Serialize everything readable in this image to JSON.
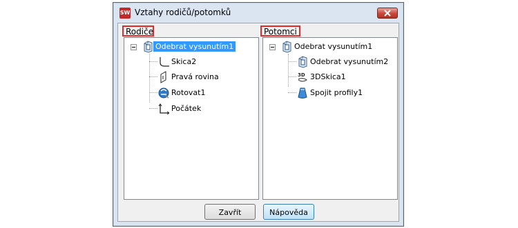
{
  "window": {
    "title": "Vztahy rodičů/potomků",
    "app_icon_text": "SW",
    "close_icon": "close-x-icon"
  },
  "parents": {
    "label": "Rodiče",
    "root": {
      "label": "Odebrat vysunutím1",
      "icon": "cut-extrude-icon",
      "selected": true,
      "expanded": true
    },
    "items": [
      {
        "label": "Skica2",
        "icon": "sketch-icon"
      },
      {
        "label": "Pravá rovina",
        "icon": "plane-icon"
      },
      {
        "label": "Rotovat1",
        "icon": "revolve-icon"
      },
      {
        "label": "Počátek",
        "icon": "origin-icon"
      }
    ]
  },
  "children": {
    "label": "Potomci",
    "root": {
      "label": "Odebrat vysunutím1",
      "icon": "cut-extrude-icon",
      "expanded": true
    },
    "items": [
      {
        "label": "Odebrat vysunutím2",
        "icon": "cut-extrude-icon"
      },
      {
        "label": "3DSkica1",
        "icon": "3d-sketch-icon"
      },
      {
        "label": "Spojit profily1",
        "icon": "loft-icon"
      }
    ]
  },
  "buttons": {
    "close": "Zavřít",
    "help": "Nápověda"
  },
  "colors": {
    "selection": "#3399ff",
    "highlight_box": "#e32a2a",
    "titlebar": "#dbe4f1"
  }
}
